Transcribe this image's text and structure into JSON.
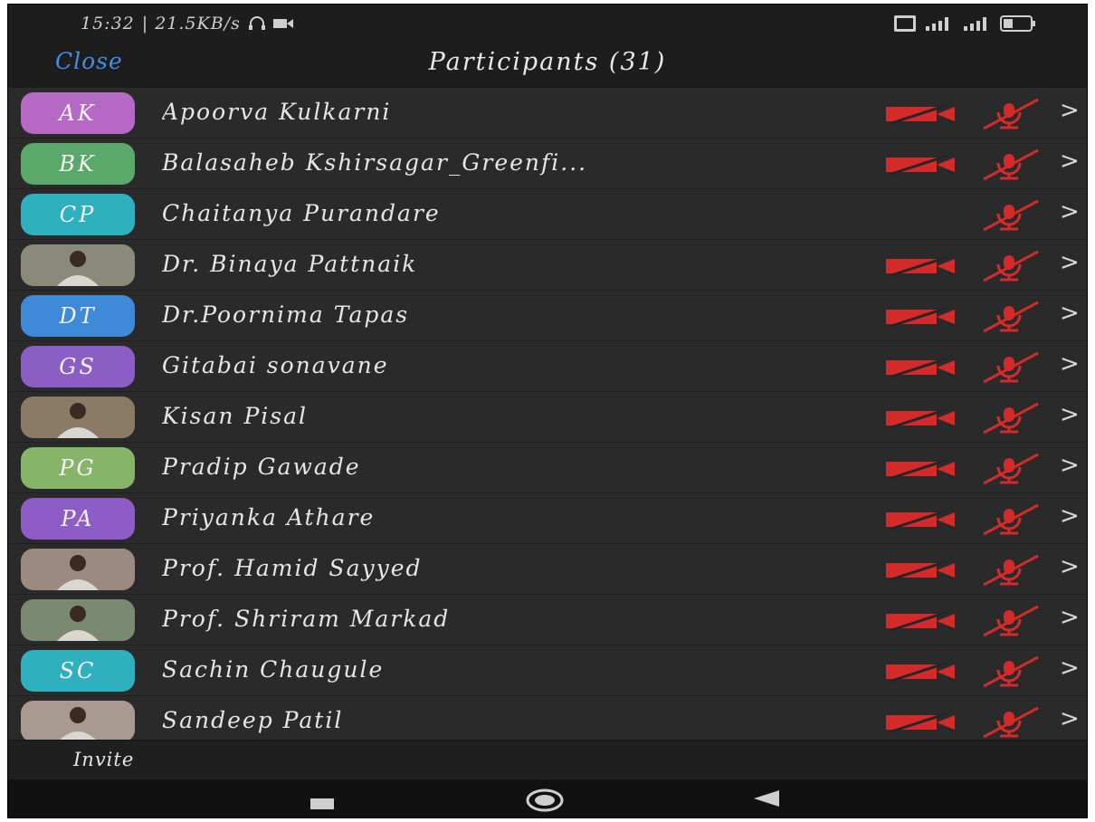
{
  "status_bar": {
    "time": "15:32",
    "speed": "| 21.5KB/s"
  },
  "header": {
    "close_label": "Close",
    "title": "Participants (31)"
  },
  "participants": [
    {
      "name": "Apoorva Kulkarni",
      "initials": "AK",
      "color": "#b569c4",
      "photo": false,
      "video_off": true,
      "mic_muted": true
    },
    {
      "name": "Balasaheb Kshirsagar_Greenfi...",
      "initials": "BK",
      "color": "#5aa86a",
      "photo": false,
      "video_off": true,
      "mic_muted": true
    },
    {
      "name": "Chaitanya Purandare",
      "initials": "CP",
      "color": "#2fb0bf",
      "photo": false,
      "video_off": false,
      "mic_muted": true
    },
    {
      "name": "Dr. Binaya Pattnaik",
      "initials": "",
      "color": "#8a8a7a",
      "photo": true,
      "video_off": true,
      "mic_muted": true
    },
    {
      "name": "Dr.Poornima Tapas",
      "initials": "DT",
      "color": "#3e8ad8",
      "photo": false,
      "video_off": true,
      "mic_muted": true
    },
    {
      "name": "Gitabai sonavane",
      "initials": "GS",
      "color": "#8a5ec4",
      "photo": false,
      "video_off": true,
      "mic_muted": true
    },
    {
      "name": "Kisan Pisal",
      "initials": "",
      "color": "#8a7a66",
      "photo": true,
      "video_off": true,
      "mic_muted": true
    },
    {
      "name": "Pradip Gawade",
      "initials": "PG",
      "color": "#86b56a",
      "photo": false,
      "video_off": true,
      "mic_muted": true
    },
    {
      "name": "Priyanka Athare",
      "initials": "PA",
      "color": "#8e5cc6",
      "photo": false,
      "video_off": true,
      "mic_muted": true
    },
    {
      "name": "Prof. Hamid Sayyed",
      "initials": "",
      "color": "#9a8a80",
      "photo": true,
      "video_off": true,
      "mic_muted": true
    },
    {
      "name": "Prof. Shriram Markad",
      "initials": "",
      "color": "#7a8a70",
      "photo": true,
      "video_off": true,
      "mic_muted": true
    },
    {
      "name": "Sachin Chaugule",
      "initials": "SC",
      "color": "#2fb0bf",
      "photo": false,
      "video_off": true,
      "mic_muted": true
    },
    {
      "name": "Sandeep Patil",
      "initials": "",
      "color": "#a89a90",
      "photo": true,
      "video_off": true,
      "mic_muted": true
    }
  ],
  "footer": {
    "invite_label": "Invite"
  },
  "icons": {
    "video": "video-off-icon",
    "mic": "mic-muted-icon",
    "chevron": ">",
    "status_right": [
      "volte-icon",
      "signal-icon",
      "signal-icon",
      "battery-icon"
    ],
    "nav": [
      "recents-icon",
      "home-icon",
      "back-icon"
    ]
  },
  "colors": {
    "accent": "#3f8fe6",
    "muted_red": "#d42a2a",
    "background": "#262626"
  }
}
